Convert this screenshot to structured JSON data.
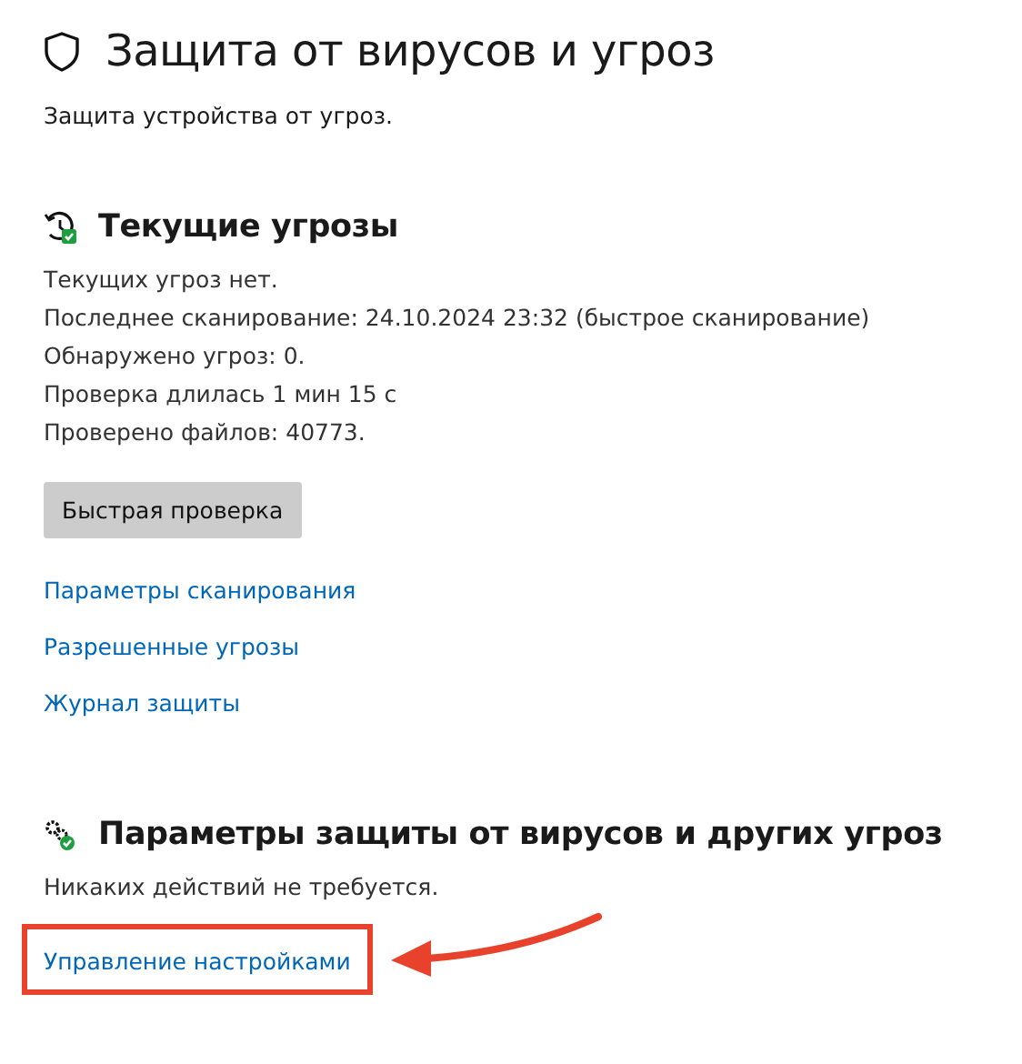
{
  "page": {
    "title": "Защита от вирусов и угроз",
    "subtitle": "Защита устройства от угроз."
  },
  "current_threats": {
    "heading": "Текущие угрозы",
    "lines": [
      "Текущих угроз нет.",
      "Последнее сканирование: 24.10.2024 23:32 (быстрое сканирование)",
      "Обнаружено угроз: 0.",
      "Проверка длилась 1 мин 15 с",
      "Проверено файлов: 40773."
    ],
    "button": "Быстрая проверка",
    "links": [
      {
        "label": "Параметры сканирования",
        "highlighted": false
      },
      {
        "label": "Разрешенные угрозы",
        "highlighted": false
      },
      {
        "label": "Журнал защиты",
        "highlighted": false
      }
    ]
  },
  "settings": {
    "heading": "Параметры защиты от вирусов и других угроз",
    "status": "Никаких действий не требуется.",
    "links": [
      {
        "label": "Управление настройками",
        "highlighted": true
      }
    ]
  }
}
